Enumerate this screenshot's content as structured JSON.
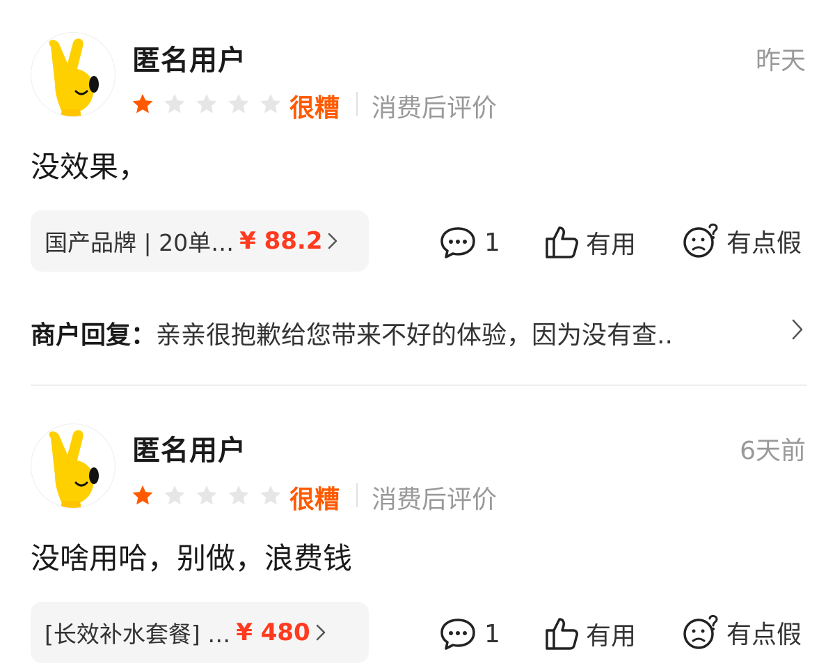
{
  "reviews": [
    {
      "username": "匿名用户",
      "time": "昨天",
      "rating_label": "很糟",
      "source": "消费后评价",
      "content": "没效果，",
      "product_name": "国产品牌 | 20单…",
      "product_price": "¥ 88.2",
      "comment_count": "1",
      "useful_label": "有用",
      "fake_label": "有点假",
      "reply_label": "商户回复：",
      "reply_text": "亲亲很抱歉给您带来不好的体验，因为没有查.."
    },
    {
      "username": "匿名用户",
      "time": "6天前",
      "rating_label": "很糟",
      "source": "消费后评价",
      "content": "没啥用哈，别做，浪费钱",
      "product_name": "[长效补水套餐] …",
      "product_price": "¥ 480",
      "comment_count": "1",
      "useful_label": "有用",
      "fake_label": "有点假"
    }
  ],
  "rating": {
    "value": 1,
    "max": 5
  },
  "colors": {
    "accent_orange": "#ff5a00",
    "price_red": "#ff3a1f",
    "star_empty": "#e6e6e6",
    "avatar_yellow": "#ffd000"
  },
  "icons": [
    "avatar-mascot",
    "star-icon",
    "comment-icon",
    "thumbs-up-icon",
    "doubt-face-icon",
    "chevron-right-icon"
  ]
}
